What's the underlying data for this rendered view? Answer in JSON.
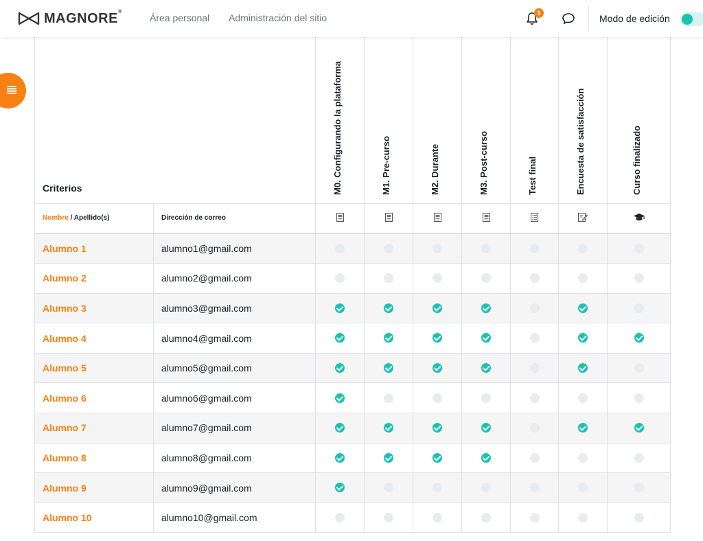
{
  "brand": {
    "name": "MAGNORE",
    "reg": "®"
  },
  "nav": {
    "links": [
      "Área personal",
      "Administración del sitio"
    ]
  },
  "notifications": {
    "count": "1"
  },
  "edit_mode": {
    "label": "Modo de edición",
    "on": true
  },
  "colors": {
    "accent": "#f98012",
    "complete": "#1bc2b1",
    "incomplete": "#e9ecef"
  },
  "table": {
    "criteria_label": "Criterios",
    "activities": [
      "M0. Configurando la plataforma",
      "M1. Pre-curso",
      "M2. Durante",
      "M3. Post-curso",
      "Test final",
      "Encuesta de satisfacción",
      "Curso finalizado"
    ],
    "activity_icons": [
      "page-icon",
      "page-icon",
      "page-icon",
      "page-icon",
      "quiz-icon",
      "feedback-icon",
      "graduation-cap-icon"
    ],
    "header": {
      "first_name": "Nombre",
      "separator": " / ",
      "last_name": "Apellido(s)",
      "email": "Dirección de correo"
    },
    "rows": [
      {
        "name": "Alumno 1",
        "email": "alumno1@gmail.com",
        "status": [
          0,
          0,
          0,
          0,
          0,
          0,
          0
        ]
      },
      {
        "name": "Alumno 2",
        "email": "alumno2@gmail.com",
        "status": [
          0,
          0,
          0,
          0,
          0,
          0,
          0
        ]
      },
      {
        "name": "Alumno 3",
        "email": "alumno3@gmail.com",
        "status": [
          1,
          1,
          1,
          1,
          0,
          1,
          0
        ]
      },
      {
        "name": "Alumno 4",
        "email": "alumno4@gmail.com",
        "status": [
          1,
          1,
          1,
          1,
          0,
          1,
          1
        ]
      },
      {
        "name": "Alumno 5",
        "email": "alumno5@gmail.com",
        "status": [
          1,
          1,
          1,
          1,
          0,
          1,
          0
        ]
      },
      {
        "name": "Alumno 6",
        "email": "alumno6@gmail.com",
        "status": [
          1,
          0,
          0,
          0,
          0,
          0,
          0
        ]
      },
      {
        "name": "Alumno 7",
        "email": "alumno7@gmail.com",
        "status": [
          1,
          1,
          1,
          1,
          0,
          1,
          1
        ]
      },
      {
        "name": "Alumno 8",
        "email": "alumno8@gmail.com",
        "status": [
          1,
          1,
          1,
          1,
          0,
          0,
          0
        ]
      },
      {
        "name": "Alumno 9",
        "email": "alumno9@gmail.com",
        "status": [
          1,
          0,
          0,
          0,
          0,
          0,
          0
        ]
      },
      {
        "name": "Alumno 10",
        "email": "alumno10@gmail.com",
        "status": [
          0,
          0,
          0,
          0,
          0,
          0,
          0
        ]
      }
    ]
  }
}
